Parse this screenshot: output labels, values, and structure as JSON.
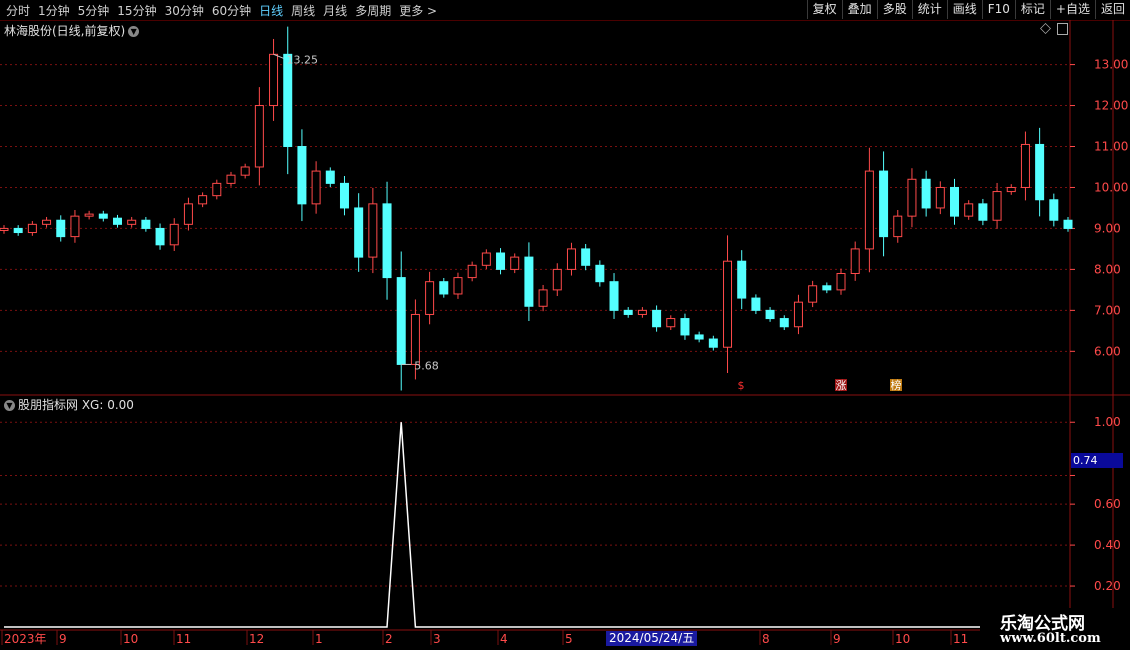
{
  "toolbar": {
    "periods": [
      "分时",
      "1分钟",
      "5分钟",
      "15分钟",
      "30分钟",
      "60分钟",
      "日线",
      "周线",
      "月线",
      "多周期",
      "更多 >"
    ],
    "active_period": "日线",
    "right_buttons": [
      "复权",
      "叠加",
      "多股",
      "统计",
      "画线",
      "F10",
      "标记",
      "+自选",
      "返回"
    ]
  },
  "main_chart": {
    "title": "林海股份(日线,前复权)",
    "high_marker": "13.25",
    "low_marker": "5.68",
    "y_ticks": [
      "13.00",
      "12.00",
      "11.00",
      "10.00",
      "9.00",
      "8.00",
      "7.00",
      "6.00"
    ],
    "badges": [
      "$",
      "涨",
      "榜"
    ]
  },
  "indicator": {
    "title": "股朋指标网 XG: 0.00",
    "y_ticks": [
      "1.00",
      "0.74",
      "0.60",
      "0.40",
      "0.20"
    ],
    "cursor_value": "0.74"
  },
  "date_axis": {
    "labels": [
      "2023年",
      "9",
      "10",
      "11",
      "12",
      "1",
      "2",
      "3",
      "4",
      "5",
      "7",
      "8",
      "9",
      "10",
      "11"
    ],
    "cursor_date": "2024/05/24/五"
  },
  "watermark": {
    "line1": "乐淘公式网",
    "line2": "www.60lt.com"
  },
  "colors": {
    "up": "#ff4a4a",
    "down": "#54ffff",
    "grid": "#7a1010",
    "axis_text": "#ff4a4a"
  },
  "chart_data": [
    {
      "type": "line",
      "title": "林海股份(日线,前复权)",
      "ylim": [
        5.3,
        13.6
      ],
      "x_labels": [
        "2023年",
        "9",
        "10",
        "11",
        "12",
        "1",
        "2",
        "3",
        "4",
        "5",
        "7",
        "8",
        "9",
        "10",
        "11"
      ],
      "series": [
        {
          "values": [
            9.0,
            8.9,
            9.1,
            9.2,
            8.8,
            9.3,
            9.35,
            9.25,
            9.1,
            9.2,
            9.0,
            8.6,
            9.1,
            9.6,
            9.8,
            10.1,
            10.3,
            10.5,
            12.0,
            13.25,
            11.0,
            9.6,
            10.4,
            10.1,
            9.5,
            8.3,
            9.6,
            7.8,
            5.68,
            6.9,
            7.7,
            7.4,
            7.8,
            8.1,
            8.4,
            8.0,
            8.3,
            7.1,
            7.5,
            8.0,
            8.5,
            8.1,
            7.7,
            7.0,
            6.9,
            7.0,
            6.6,
            6.8,
            6.4,
            6.3,
            6.1,
            8.2,
            7.3,
            7.0,
            6.8,
            6.6,
            7.2,
            7.6,
            7.5,
            7.9,
            8.5,
            10.4,
            8.8,
            9.3,
            10.2,
            9.5,
            10.0,
            9.3,
            9.6,
            9.2,
            9.9,
            10.0,
            11.05,
            9.7,
            9.2,
            9.0
          ]
        }
      ]
    },
    {
      "type": "line",
      "title": "股朋指标网 XG: 0.00",
      "ylim": [
        0,
        1.05
      ],
      "series": [
        {
          "values": [
            0,
            0,
            0,
            0,
            0,
            0,
            0,
            0,
            0,
            0,
            0,
            0,
            0,
            0,
            0,
            0,
            0,
            0,
            0,
            0,
            0,
            0,
            0,
            0,
            0,
            0,
            0,
            0,
            1,
            0,
            0,
            0,
            0,
            0,
            0,
            0,
            0,
            0,
            0,
            0,
            0,
            0,
            0,
            0,
            0,
            0,
            0,
            0,
            0,
            0,
            0,
            0,
            0,
            0,
            0,
            0,
            0,
            0,
            0,
            0,
            0,
            0,
            0,
            0,
            0,
            0,
            0,
            0,
            0,
            0,
            0,
            0,
            0,
            0,
            0,
            0
          ]
        }
      ]
    }
  ]
}
